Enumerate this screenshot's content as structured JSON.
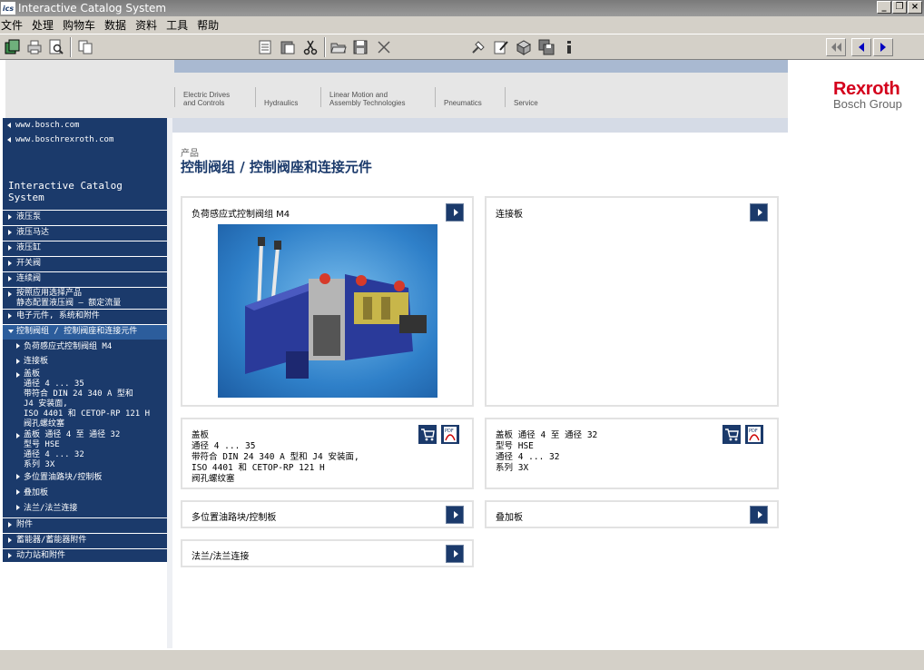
{
  "window": {
    "title": "Interactive Catalog System",
    "logo_text": "ics"
  },
  "menu": [
    "文件",
    "处理",
    "购物车",
    "数据",
    "资料",
    "工具",
    "帮助"
  ],
  "toolbar": {
    "icons": [
      "catalog-icon",
      "print-icon",
      "print-preview-icon",
      "copy-icon",
      "notes-icon",
      "clipboard-icon",
      "cut-icon",
      "open-folder-icon",
      "save-icon",
      "close-icon",
      "tools-icon",
      "edit-icon",
      "package-icon",
      "save-all-icon",
      "info-icon",
      "first-page-icon",
      "back-icon",
      "forward-icon"
    ]
  },
  "top_nav": [
    {
      "line1": "Electric Drives",
      "line2": "and Controls"
    },
    {
      "line1": "",
      "line2": "Hydraulics"
    },
    {
      "line1": "Linear Motion and",
      "line2": "Assembly Technologies"
    },
    {
      "line1": "",
      "line2": "Pneumatics"
    },
    {
      "line1": "",
      "line2": "Service"
    }
  ],
  "brand": {
    "name": "Rexroth",
    "group": "Bosch Group"
  },
  "sidebar": {
    "links": [
      "www.bosch.com",
      "www.boschrexroth.com"
    ],
    "title": "Interactive Catalog System",
    "items": [
      {
        "label": "液压泵"
      },
      {
        "label": "液压马达"
      },
      {
        "label": "液压缸"
      },
      {
        "label": "开关阀"
      },
      {
        "label": "连续阀"
      },
      {
        "label": "按照应用选择产品\n静态配置液压阀 – 额定流量"
      },
      {
        "label": "电子元件, 系统和附件"
      },
      {
        "label": "控制阀组 / 控制阀座和连接元件"
      },
      {
        "label": "负荷感应式控制阀组 M4"
      },
      {
        "label": "连接板"
      },
      {
        "label": "盖板\n通径 4 ... 35\n带符合 DIN 24 340 A 型和\nJ4 安装面,\nISO 4401 和 CETOP-RP 121 H\n阀孔螺纹塞"
      },
      {
        "label": "盖板 通径 4 至 通径 32\n型号 HSE\n通径 4 ... 32\n系列 3X"
      },
      {
        "label": "多位置油路块/控制板"
      },
      {
        "label": "叠加板"
      },
      {
        "label": "法兰/法兰连接"
      },
      {
        "label": "附件"
      },
      {
        "label": "蓄能器/蓄能器附件"
      },
      {
        "label": "动力站和附件"
      }
    ]
  },
  "main": {
    "breadcrumb": "产品",
    "title": "控制阀组 / 控制阀座和连接元件",
    "cards": [
      {
        "title": "负荷感应式控制阀组 M4",
        "image": "m4-control-block-photo"
      },
      {
        "title": "连接板"
      },
      {
        "title": "盖板\n通径 4 ... 35\n带符合 DIN 24 340 A 型和 J4 安装面,\nISO 4401 和 CETOP-RP 121 H\n阀孔螺纹塞",
        "cart_icon": "cart-icon",
        "pdf_icon": "pdf-icon"
      },
      {
        "title": "盖板 通径 4 至 通径 32\n型号 HSE\n通径 4 ... 32\n系列 3X",
        "cart_icon": "cart-icon",
        "pdf_icon": "pdf-icon"
      },
      {
        "title": "多位置油路块/控制板"
      },
      {
        "title": "叠加板"
      },
      {
        "title": "法兰/法兰连接"
      }
    ]
  }
}
